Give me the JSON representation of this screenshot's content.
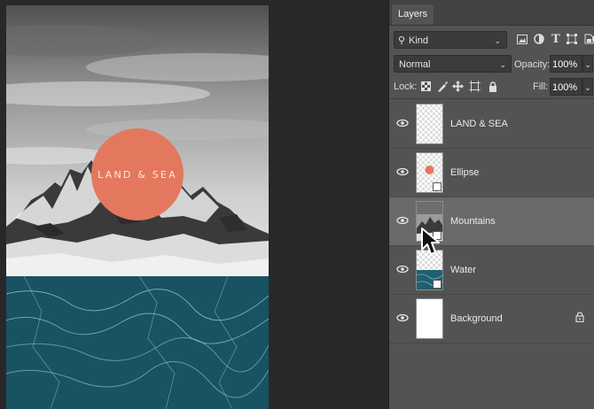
{
  "canvas": {
    "ellipse_text": "LAND & SEA"
  },
  "panel": {
    "tab_label": "Layers",
    "filter": {
      "kind_label": "Kind",
      "icons": [
        "pixel-filter-icon",
        "adjustment-filter-icon",
        "type-filter-icon",
        "shape-filter-icon",
        "smart-object-filter-icon",
        "filter-toggle-icon"
      ]
    },
    "blend_mode": "Normal",
    "opacity_label": "Opacity:",
    "opacity_value": "100%",
    "lock_label": "Lock:",
    "lock_icons": [
      "lock-transparent-pixels-icon",
      "lock-image-pixels-icon",
      "lock-position-icon",
      "lock-artboard-icon",
      "lock-all-icon"
    ],
    "fill_label": "Fill:",
    "fill_value": "100%"
  },
  "layers": [
    {
      "name": "LAND & SEA",
      "kind": "text",
      "visible": true,
      "selected": false,
      "locked": false
    },
    {
      "name": "Ellipse",
      "kind": "shape",
      "visible": true,
      "selected": false,
      "locked": false
    },
    {
      "name": "Mountains",
      "kind": "smart-object",
      "visible": true,
      "selected": true,
      "locked": false
    },
    {
      "name": "Water",
      "kind": "smart-object",
      "visible": true,
      "selected": false,
      "locked": false
    },
    {
      "name": "Background",
      "kind": "pixel",
      "visible": true,
      "selected": false,
      "locked": true
    }
  ],
  "colors": {
    "ellipse": "#e3785e",
    "panel_bg": "#535353",
    "selected_row": "#6a6a6a",
    "water": "#1f5f70"
  }
}
